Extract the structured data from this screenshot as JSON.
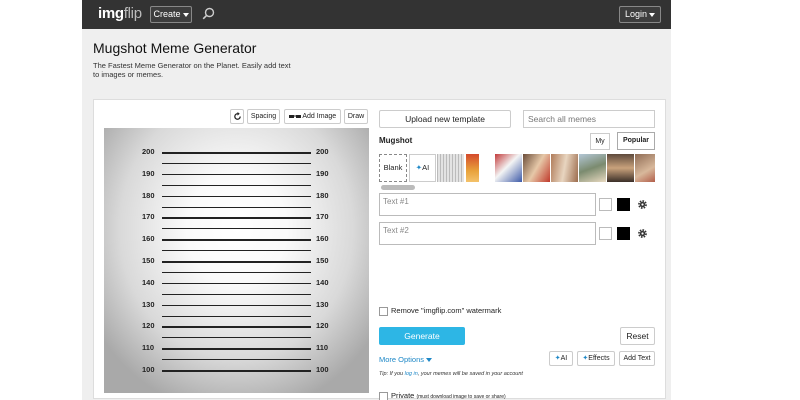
{
  "header": {
    "logo_main": "img",
    "logo_accent": "flip",
    "create_label": "Create",
    "login_label": "Login"
  },
  "page": {
    "title": "Mugshot Meme Generator",
    "subtitle": "The Fastest Meme Generator on the Planet. Easily add text to images or memes."
  },
  "toolbar": {
    "spacing_label": "Spacing",
    "add_image_label": "Add Image",
    "draw_label": "Draw"
  },
  "mugshot_heights": [
    "200",
    "190",
    "180",
    "170",
    "160",
    "150",
    "140",
    "130",
    "120",
    "110",
    "100"
  ],
  "templates": {
    "upload_label": "Upload new template",
    "search_placeholder": "Search all memes",
    "current_name": "Mugshot",
    "my_label": "My",
    "popular_label": "Popular",
    "blank_label": "Blank",
    "ai_label": "AI"
  },
  "text_boxes": {
    "text1_placeholder": "Text #1",
    "text2_placeholder": "Text #2"
  },
  "options": {
    "more_options_label": "More Options",
    "ai_label": "AI",
    "effects_label": "Effects",
    "add_text_label": "Add Text",
    "tip_prefix": "Tip: If you ",
    "tip_link": "log in",
    "tip_suffix": ", your memes will be saved in your account",
    "private_label": "Private",
    "private_note": "(must download image to save or share)",
    "watermark_label": "Remove \"imgflip.com\" watermark",
    "generate_label": "Generate",
    "reset_label": "Reset"
  },
  "colors": {
    "topbar": "#333333",
    "generate_button": "#2db6e5",
    "link": "#1e88c7"
  },
  "icons": {
    "search": "search-icon",
    "rotate": "rotate-icon",
    "glasses": "glasses-icon",
    "gear": "gear-icon",
    "sparkle": "sparkle-icon"
  }
}
